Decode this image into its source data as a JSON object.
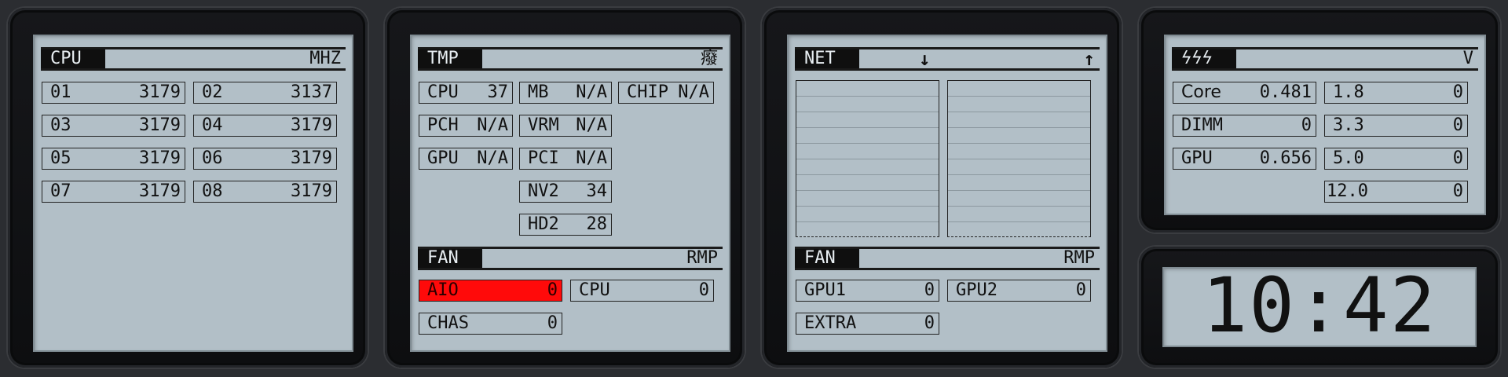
{
  "cpu": {
    "tag": "CPU",
    "unit": "MHZ",
    "cores": [
      {
        "label": "01",
        "value": "3179"
      },
      {
        "label": "02",
        "value": "3137"
      },
      {
        "label": "03",
        "value": "3179"
      },
      {
        "label": "04",
        "value": "3179"
      },
      {
        "label": "05",
        "value": "3179"
      },
      {
        "label": "06",
        "value": "3179"
      },
      {
        "label": "07",
        "value": "3179"
      },
      {
        "label": "08",
        "value": "3179"
      }
    ]
  },
  "tmp": {
    "tag": "TMP",
    "unit": "癈",
    "sensors": [
      {
        "label": "CPU",
        "value": "37"
      },
      {
        "label": "MB",
        "value": "N/A"
      },
      {
        "label": "CHIP",
        "value": "N/A"
      },
      {
        "label": "PCH",
        "value": "N/A"
      },
      {
        "label": "VRM",
        "value": "N/A"
      },
      {
        "label": "GPU",
        "value": "N/A"
      },
      {
        "label": "PCI",
        "value": "N/A"
      },
      {
        "label": "NV2",
        "value": "34"
      },
      {
        "label": "HD2",
        "value": "28"
      }
    ]
  },
  "fan1": {
    "tag": "FAN",
    "unit": "RMP",
    "fans": [
      {
        "label": "AIO",
        "value": "0"
      },
      {
        "label": "CPU",
        "value": "0"
      },
      {
        "label": "CHAS",
        "value": "0"
      }
    ]
  },
  "net": {
    "tag": "NET",
    "down_icon": "arrow-down-icon",
    "up_icon": "arrow-up-icon"
  },
  "fan2": {
    "tag": "FAN",
    "unit": "RMP",
    "fans": [
      {
        "label": "GPU1",
        "value": "0"
      },
      {
        "label": "GPU2",
        "value": "0"
      },
      {
        "label": "EXTRA",
        "value": "0"
      }
    ]
  },
  "volt": {
    "tag_icon": "lightning-icon",
    "tag": "ϟϟϟ",
    "unit": "V",
    "rails": [
      {
        "label": "Core",
        "value": "0.481"
      },
      {
        "label": "1.8",
        "value": "0"
      },
      {
        "label": "DIMM",
        "value": "0"
      },
      {
        "label": "3.3",
        "value": "0"
      },
      {
        "label": "GPU",
        "value": "0.656"
      },
      {
        "label": "5.0",
        "value": "0"
      },
      {
        "label": "12.0",
        "value": "0"
      }
    ]
  },
  "clock": {
    "time": "10:42"
  },
  "colors": {
    "screen": "#b2bfc7",
    "alarm": "#ff0a0a",
    "bezel": "#121316"
  }
}
